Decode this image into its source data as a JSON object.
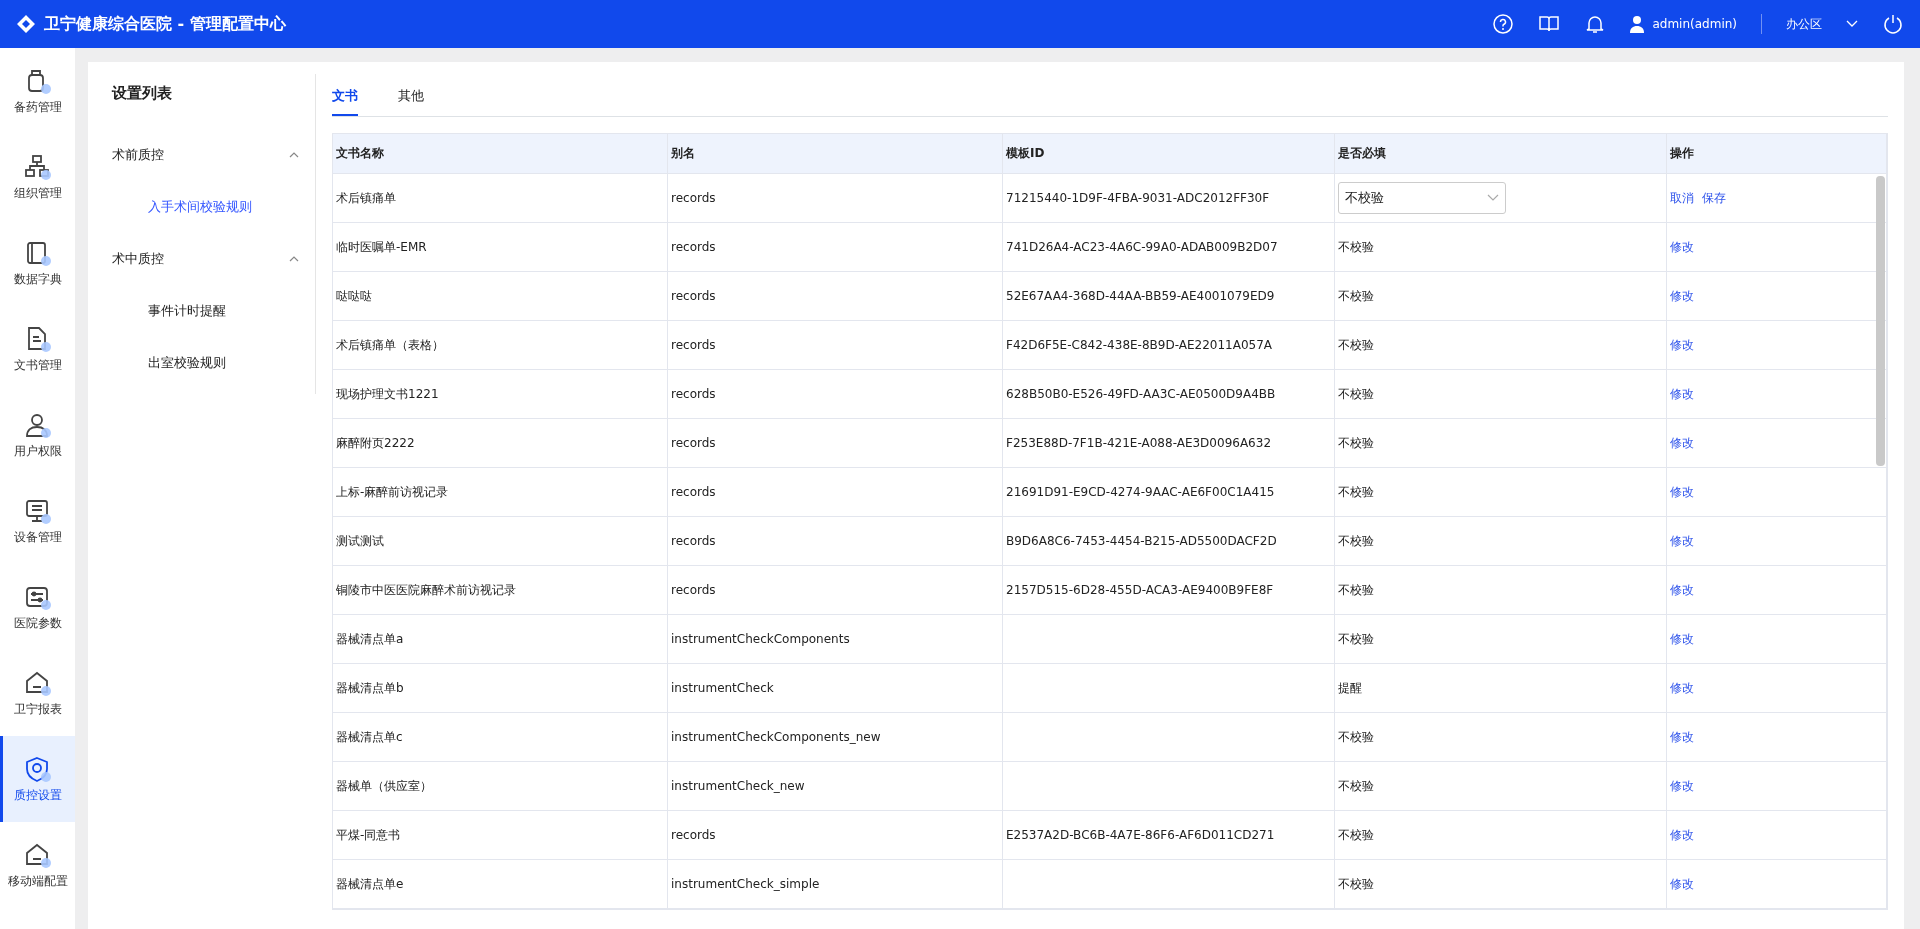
{
  "header": {
    "title": "卫宁健康综合医院 - 管理配置中心",
    "user": "admin(admin)",
    "workspace": "办公区"
  },
  "nav": [
    {
      "label": "备药管理",
      "selected": false
    },
    {
      "label": "组织管理",
      "selected": false
    },
    {
      "label": "数据字典",
      "selected": false
    },
    {
      "label": "文书管理",
      "selected": false
    },
    {
      "label": "用户权限",
      "selected": false
    },
    {
      "label": "设备管理",
      "selected": false
    },
    {
      "label": "医院参数",
      "selected": false
    },
    {
      "label": "卫宁报表",
      "selected": false
    },
    {
      "label": "质控设置",
      "selected": true
    },
    {
      "label": "移动端配置",
      "selected": false
    }
  ],
  "settings": {
    "title": "设置列表",
    "groups": [
      {
        "label": "术前质控",
        "expanded": true,
        "children": [
          {
            "label": "入手术间校验规则",
            "selected": true
          }
        ]
      },
      {
        "label": "术中质控",
        "expanded": true,
        "children": [
          {
            "label": "事件计时提醒",
            "selected": false
          },
          {
            "label": "出室校验规则",
            "selected": false
          }
        ]
      }
    ]
  },
  "tabs": [
    {
      "label": "文书",
      "selected": true
    },
    {
      "label": "其他",
      "selected": false
    }
  ],
  "table": {
    "columns": [
      "文书名称",
      "别名",
      "模板ID",
      "是否必填",
      "操作"
    ],
    "rows": [
      {
        "name": "术后镇痛单",
        "alias": "records",
        "template_id": "71215440-1D9F-4FBA-9031-ADC2012FF30F",
        "required": "不校验",
        "editing": true,
        "actions": [
          "取消",
          "保存"
        ]
      },
      {
        "name": "临时医嘱单-EMR",
        "alias": "records",
        "template_id": "741D26A4-AC23-4A6C-99A0-ADAB009B2D07",
        "required": "不校验",
        "editing": false,
        "actions": [
          "修改"
        ]
      },
      {
        "name": "哒哒哒",
        "alias": "records",
        "template_id": "52E67AA4-368D-44AA-BB59-AE4001079ED9",
        "required": "不校验",
        "editing": false,
        "actions": [
          "修改"
        ]
      },
      {
        "name": "术后镇痛单（表格）",
        "alias": "records",
        "template_id": "F42D6F5E-C842-438E-8B9D-AE22011A057A",
        "required": "不校验",
        "editing": false,
        "actions": [
          "修改"
        ]
      },
      {
        "name": "现场护理文书1221",
        "alias": "records",
        "template_id": "628B50B0-E526-49FD-AA3C-AE0500D9A4BB",
        "required": "不校验",
        "editing": false,
        "actions": [
          "修改"
        ]
      },
      {
        "name": "麻醉附页2222",
        "alias": "records",
        "template_id": "F253E88D-7F1B-421E-A088-AE3D0096A632",
        "required": "不校验",
        "editing": false,
        "actions": [
          "修改"
        ]
      },
      {
        "name": "上标-麻醉前访视记录",
        "alias": "records",
        "template_id": "21691D91-E9CD-4274-9AAC-AE6F00C1A415",
        "required": "不校验",
        "editing": false,
        "actions": [
          "修改"
        ]
      },
      {
        "name": "测试测试",
        "alias": "records",
        "template_id": "B9D6A8C6-7453-4454-B215-AD5500DACF2D",
        "required": "不校验",
        "editing": false,
        "actions": [
          "修改"
        ]
      },
      {
        "name": "铜陵市中医医院麻醉术前访视记录",
        "alias": "records",
        "template_id": "2157D515-6D28-455D-ACA3-AE9400B9FE8F",
        "required": "不校验",
        "editing": false,
        "actions": [
          "修改"
        ]
      },
      {
        "name": "器械清点单a",
        "alias": "instrumentCheckComponents",
        "required": "不校验",
        "editing": false,
        "actions": [
          "修改"
        ]
      },
      {
        "name": "器械清点单b",
        "alias": "instrumentCheck",
        "required": "提醒",
        "editing": false,
        "actions": [
          "修改"
        ]
      },
      {
        "name": "器械清点单c",
        "alias": "instrumentCheckComponents_new",
        "required": "不校验",
        "editing": false,
        "actions": [
          "修改"
        ]
      },
      {
        "name": "器械单（供应室）",
        "alias": "instrumentCheck_new",
        "required": "不校验",
        "editing": false,
        "actions": [
          "修改"
        ]
      },
      {
        "name": "平煤-同意书",
        "alias": "records",
        "template_id": "E2537A2D-BC6B-4A7E-86F6-AF6D011CD271",
        "required": "不校验",
        "editing": false,
        "actions": [
          "修改"
        ]
      },
      {
        "name": "器械清点单e",
        "alias": "instrumentCheck_simple",
        "required": "不校验",
        "editing": false,
        "actions": [
          "修改"
        ]
      }
    ]
  }
}
